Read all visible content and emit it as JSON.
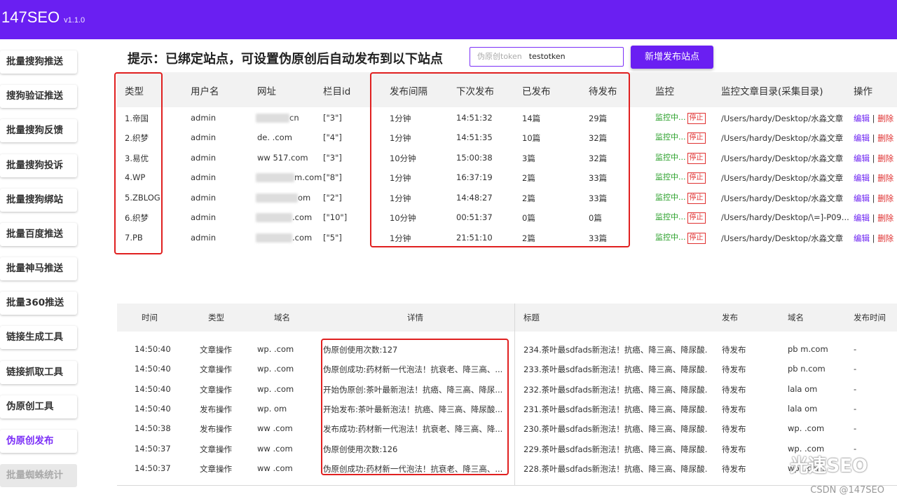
{
  "app": {
    "name": "147SEO",
    "version": "v1.1.0"
  },
  "sidebar": {
    "items": [
      {
        "label": "批量搜狗推送"
      },
      {
        "label": "搜狗验证推送"
      },
      {
        "label": "批量搜狗反馈"
      },
      {
        "label": "批量搜狗投诉"
      },
      {
        "label": "批量搜狗绑站"
      },
      {
        "label": "批量百度推送"
      },
      {
        "label": "批量神马推送"
      },
      {
        "label": "批量360推送"
      },
      {
        "label": "链接生成工具"
      },
      {
        "label": "链接抓取工具"
      },
      {
        "label": "伪原创工具"
      },
      {
        "label": "伪原创发布"
      },
      {
        "label": "批量蜘蛛统计"
      }
    ]
  },
  "tip": "提示：已绑定站点，可设置伪原创后自动发布到以下站点",
  "token": {
    "placeholder": "伪原创token",
    "value": "testotken"
  },
  "add_button": "新增发布站点",
  "sites": {
    "headers": [
      "类型",
      "用户名",
      "网址",
      "栏目id",
      "发布间隔",
      "下次发布",
      "已发布",
      "待发布",
      "监控",
      "监控文章目录(采集目录)",
      "操作"
    ],
    "rows": [
      {
        "type": "1.帝国",
        "user": "admin",
        "url": "cn",
        "cat": "[\"3\"]",
        "interval": "1分钟",
        "next": "14:51:32",
        "done": "14篇",
        "pending": "29篇",
        "dir": "/Users/hardy/Desktop/水淼文章"
      },
      {
        "type": "2.织梦",
        "user": "admin",
        "url": "de.        .com",
        "cat": "[\"4\"]",
        "interval": "1分钟",
        "next": "14:51:35",
        "done": "10篇",
        "pending": "32篇",
        "dir": "/Users/hardy/Desktop/水淼文章"
      },
      {
        "type": "3.易优",
        "user": "admin",
        "url": "ww      517.com",
        "cat": "[\"3\"]",
        "interval": "10分钟",
        "next": "15:00:38",
        "done": "3篇",
        "pending": "32篇",
        "dir": "/Users/hardy/Desktop/水淼文章"
      },
      {
        "type": "4.WP",
        "user": "admin",
        "url": "m.com",
        "cat": "[\"8\"]",
        "interval": "1分钟",
        "next": "16:37:19",
        "done": "2篇",
        "pending": "33篇",
        "dir": "/Users/hardy/Desktop/水淼文章"
      },
      {
        "type": "5.ZBLOG",
        "user": "admin",
        "url": "om",
        "cat": "[\"2\"]",
        "interval": "1分钟",
        "next": "14:48:27",
        "done": "2篇",
        "pending": "33篇",
        "dir": "/Users/hardy/Desktop/水淼文章"
      },
      {
        "type": "6.织梦",
        "user": "admin",
        "url": ".com",
        "cat": "[\"10\"]",
        "interval": "10分钟",
        "next": "00:51:37",
        "done": "0篇",
        "pending": "0篇",
        "dir": "/Users/hardy/Desktop/\\=]-P09..."
      },
      {
        "type": "7.PB",
        "user": "admin",
        "url": ".com",
        "cat": "[\"5\"]",
        "interval": "1分钟",
        "next": "21:51:10",
        "done": "2篇",
        "pending": "33篇",
        "dir": "/Users/hardy/Desktop/水淼文章"
      }
    ],
    "monitor_label": "监控中...",
    "stop_label": "停止",
    "edit_label": "编辑",
    "sep": "|",
    "delete_label": "删除"
  },
  "logs": {
    "headers": [
      "时间",
      "类型",
      "域名",
      "详情",
      "标题",
      "发布",
      "域名",
      "发布时间"
    ],
    "rows": [
      {
        "time": "14:50:40",
        "type": "文章操作",
        "domain": "wp.        .com",
        "detail": "伪原创使用次数:127",
        "title": "234.茶叶最sdfads新泡法！抗癌、降三高、降尿酸...",
        "pub": "待发布",
        "domain2": "pb        m.com",
        "pubtime": "-"
      },
      {
        "time": "14:50:40",
        "type": "文章操作",
        "domain": "wp.        .com",
        "detail": "伪原创成功:药材新一代泡法！抗衰老、降三高、...",
        "title": "233.茶叶最sdfads新泡法！抗癌、降三高、降尿酸...",
        "pub": "待发布",
        "domain2": "pb        n.com",
        "pubtime": "-"
      },
      {
        "time": "14:50:40",
        "type": "文章操作",
        "domain": "wp.        .com",
        "detail": "开始伪原创:茶叶最新泡法！抗癌、降三高、降尿...",
        "title": "232.茶叶最sdfads新泡法！抗癌、降三高、降尿酸...",
        "pub": "待发布",
        "domain2": "lala        om",
        "pubtime": "-"
      },
      {
        "time": "14:50:40",
        "type": "发布操作",
        "domain": "wp.          om",
        "detail": "开始发布:茶叶最新泡法！抗癌、降三高、降尿酸...",
        "title": "231.茶叶最sdfads新泡法！抗癌、降三高、降尿酸...",
        "pub": "待发布",
        "domain2": "lala        om",
        "pubtime": "-"
      },
      {
        "time": "14:50:38",
        "type": "发布操作",
        "domain": "ww          .com",
        "detail": "发布成功:药材新一代泡法！抗衰老、降三高、降...",
        "title": "230.茶叶最sdfads新泡法！抗癌、降三高、降尿酸...",
        "pub": "待发布",
        "domain2": "wp.        .com",
        "pubtime": "-"
      },
      {
        "time": "14:50:37",
        "type": "文章操作",
        "domain": "ww          .com",
        "detail": "伪原创使用次数:126",
        "title": "229.茶叶最sdfads新泡法！抗癌、降三高、降尿酸...",
        "pub": "待发布",
        "domain2": "wp.        .com",
        "pubtime": "-"
      },
      {
        "time": "14:50:37",
        "type": "文章操作",
        "domain": "ww          .com",
        "detail": "伪原创成功:药材新一代泡法！抗衰老、降三高、...",
        "title": "228.茶叶最sdfads新泡法！抗癌、降三高、降尿酸...",
        "pub": "待发布",
        "domain2": "wp.        .com",
        "pubtime": "-"
      }
    ]
  },
  "watermark": {
    "main": "光速SEO",
    "sub": "CSDN @147SEO"
  }
}
